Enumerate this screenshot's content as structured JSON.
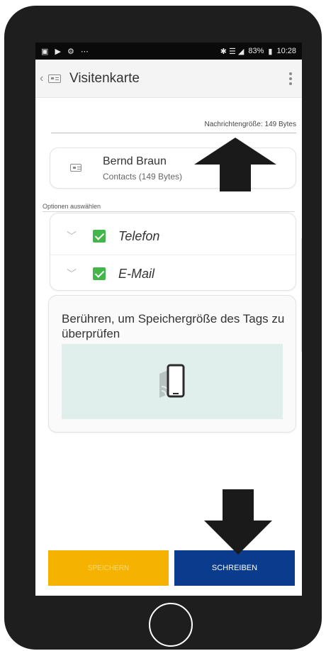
{
  "statusbar": {
    "left_icons": "▣ ▶ ⚙ ⋯",
    "right_icons": "✱ ☰ ◢",
    "battery": "83%",
    "time": "10:28"
  },
  "appbar": {
    "back_glyph": "‹",
    "title": "Visitenkarte"
  },
  "message_size": "Nachrichtengröße: 149 Bytes",
  "contact": {
    "name": "Bernd Braun",
    "subtitle": "Contacts (149 Bytes)"
  },
  "options": {
    "label": "Optionen auswählen",
    "items": [
      {
        "label": "Telefon",
        "checked": true
      },
      {
        "label": "E-Mail",
        "checked": true
      }
    ]
  },
  "tag_check": {
    "text": "Berühren, um Speichergröße des Tags zu überprüfen",
    "icon": "nfc-phone-icon"
  },
  "buttons": {
    "save": "SPEICHERN",
    "write": "SCHREIBEN"
  },
  "colors": {
    "save_button": "#f5b300",
    "write_button": "#0a3b8c",
    "checkbox": "#43b649",
    "tag_area": "#e0efec",
    "annotation_arrow": "#1a1a1a"
  }
}
